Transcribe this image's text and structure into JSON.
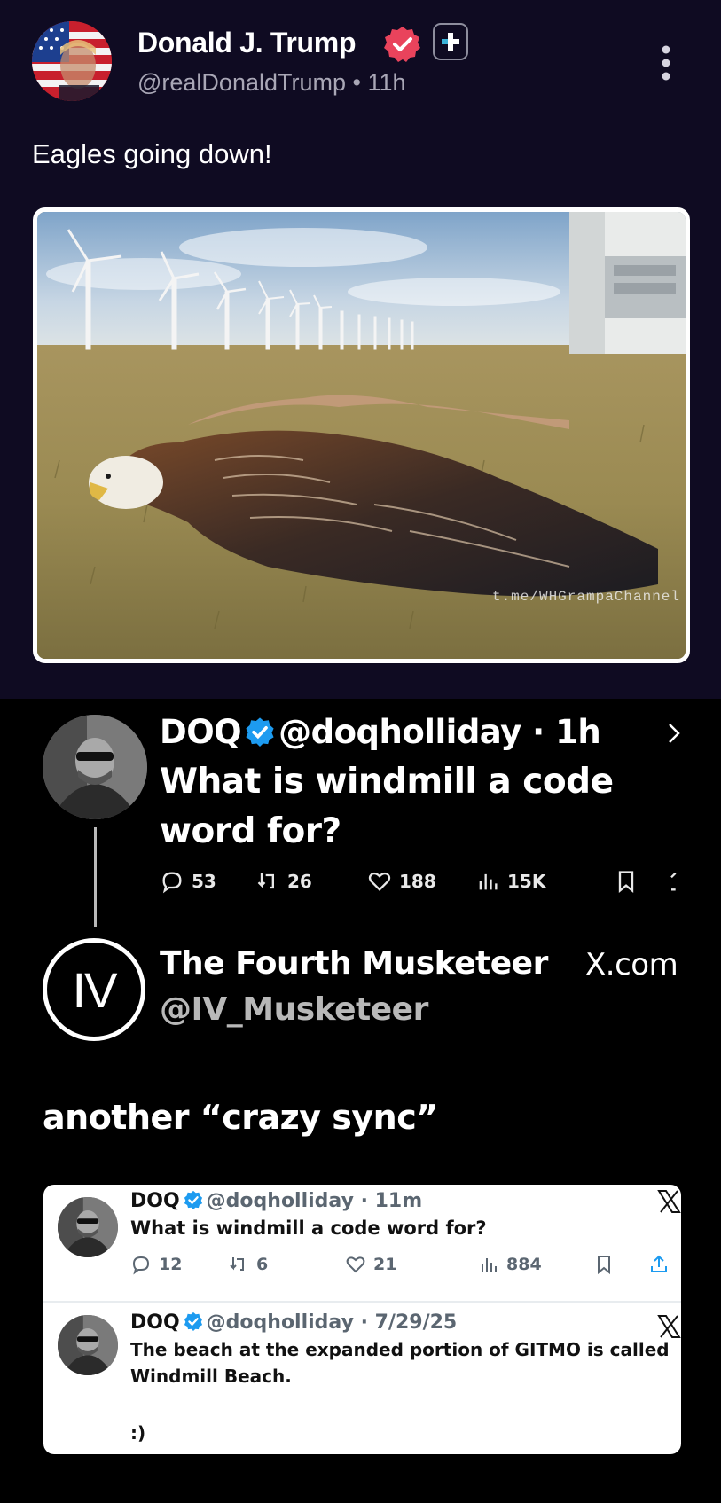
{
  "post": {
    "author_name": "Donald J. Trump",
    "handle_time": "@realDonaldTrump • 11h",
    "text": "Eagles going down!",
    "media_watermark": "t.me/WHGrampaChannel"
  },
  "embedded": {
    "parent_tweet": {
      "name": "DOQ",
      "handle_time": "@doqholliday · 1h",
      "text": "What is windmill a code word for?",
      "replies": "53",
      "reposts": "26",
      "likes": "188",
      "views": "15K"
    },
    "reply_author": {
      "name": "The Fourth Musketeer",
      "handle": "@IV_Musketeer",
      "avatar_text": "IV",
      "site_label": "X.com",
      "text": "another “crazy sync”"
    },
    "quoted_tweets": [
      {
        "name": "DOQ",
        "handle_time": "@doqholliday · 11m",
        "text": "What is windmill a code word for?",
        "replies": "12",
        "reposts": "6",
        "likes": "21",
        "views": "884"
      },
      {
        "name": "DOQ",
        "handle_time": "@doqholliday · 7/29/25",
        "text_line1": "The beach at the expanded portion of GITMO is called",
        "text_line2": "Windmill Beach.",
        "text_line3": ":)"
      }
    ]
  },
  "colors": {
    "top_background": "#0f0b22",
    "verified_pink": "#e9435c",
    "verified_blue": "#1d9bf0"
  }
}
